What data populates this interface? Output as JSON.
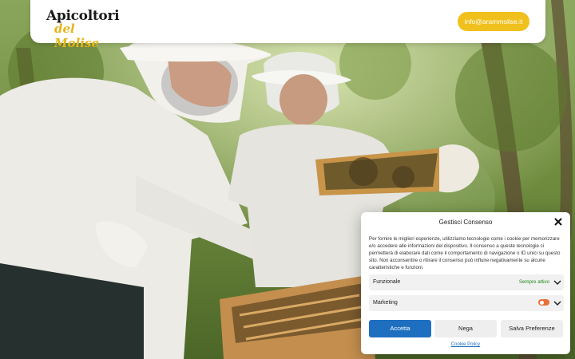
{
  "header": {
    "logo_line1": "Apicoltori",
    "logo_line2": "del Molise",
    "email_label": "info@arammolise.it"
  },
  "cookie": {
    "title": "Gestisci Consenso",
    "body": "Per fornire le migliori esperienze, utilizziamo tecnologie come i cookie per memorizzare e/o accedere alle informazioni del dispositivo. Il consenso a queste tecnologie ci permetterà di elaborare dati come il comportamento di navigazione o ID unici su questo sito. Non acconsentire o ritirare il consenso può influire negativamente su alcune caratteristiche e funzioni.",
    "categories": [
      {
        "label": "Funzionale",
        "status": "Sempre attivo"
      },
      {
        "label": "Marketing",
        "status": ""
      }
    ],
    "accept_label": "Accetta",
    "deny_label": "Nega",
    "prefs_label": "Salva Preferenze",
    "policy_label": "Cookie Policy",
    "accent_color": "#1f6fc0"
  }
}
